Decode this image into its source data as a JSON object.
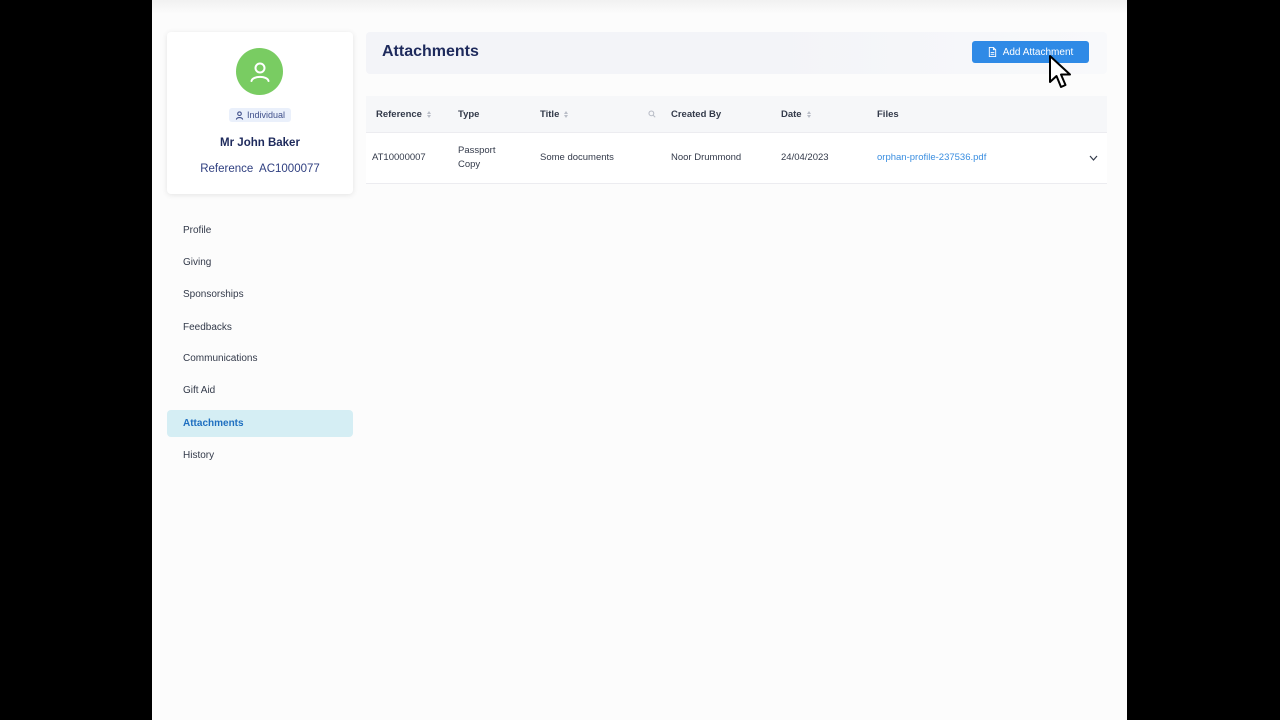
{
  "profile": {
    "badge_label": "Individual",
    "name": "Mr John Baker",
    "reference_line": "Reference  AC1000077",
    "avatar_icon": "user-icon",
    "avatar_color": "#79cc62"
  },
  "nav": {
    "items": [
      {
        "label": "Profile",
        "active": false
      },
      {
        "label": "Giving",
        "active": false
      },
      {
        "label": "Sponsorships",
        "active": false
      },
      {
        "label": "Feedbacks",
        "active": false
      },
      {
        "label": "Communications",
        "active": false
      },
      {
        "label": "Gift Aid",
        "active": false
      },
      {
        "label": "Attachments",
        "active": true
      },
      {
        "label": "History",
        "active": false
      }
    ]
  },
  "header": {
    "title": "Attachments",
    "add_button_label": "Add Attachment",
    "add_button_icon": "document-icon",
    "accent_color": "#2f8ae6"
  },
  "table": {
    "columns": [
      {
        "label": "Reference",
        "sortable": true
      },
      {
        "label": "Type",
        "sortable": false
      },
      {
        "label": "Title",
        "sortable": true,
        "searchable": true
      },
      {
        "label": "Created By",
        "sortable": false
      },
      {
        "label": "Date",
        "sortable": true
      },
      {
        "label": "Files",
        "sortable": false
      }
    ],
    "rows": [
      {
        "reference": "AT10000007",
        "type_line1": "Passport",
        "type_line2": "Copy",
        "title": "Some documents",
        "created_by": "Noor Drummond",
        "date": "24/04/2023",
        "file": "orphan-profile-237536.pdf"
      }
    ]
  }
}
